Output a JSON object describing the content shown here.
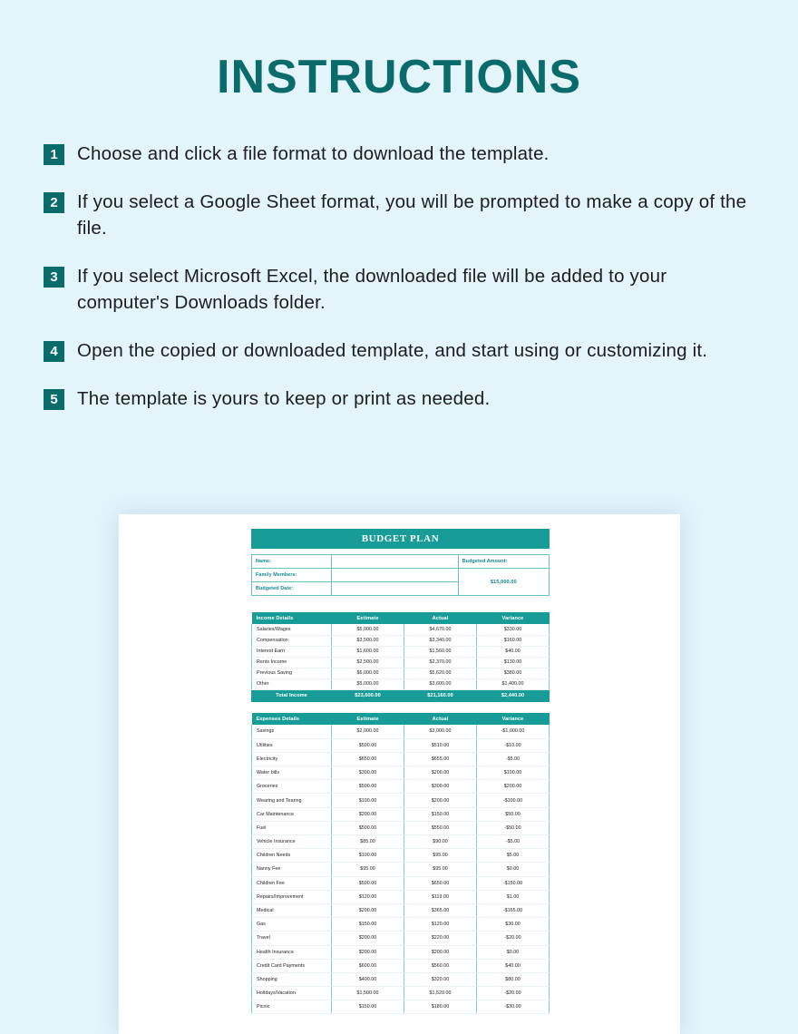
{
  "header": {
    "title": "INSTRUCTIONS"
  },
  "steps": [
    {
      "number": "1",
      "text": "Choose and click a file format to download the template."
    },
    {
      "number": "2",
      "text": "If you select a Google Sheet format, you will be prompted to make a copy of the file."
    },
    {
      "number": "3",
      "text": "If you select Microsoft Excel, the downloaded file will be added to your computer's Downloads folder."
    },
    {
      "number": "4",
      "text": "Open the copied or downloaded template, and start using or customizing it."
    },
    {
      "number": "5",
      "text": "The template is yours to keep or print as needed."
    }
  ],
  "preview": {
    "doc_title": "BUDGET PLAN",
    "info": {
      "name_label": "Name:",
      "name_value": "",
      "family_label": "Family Members:",
      "family_value": "",
      "date_label": "Budgeted Date:",
      "date_value": "",
      "budgeted_amount_label": "Budgeted Amount:",
      "budgeted_amount_value": "$15,000.00"
    },
    "income": {
      "headers": [
        "Income Details",
        "Estimate",
        "Actual",
        "Variance"
      ],
      "rows": [
        [
          "Salaries/Wages",
          "$5,000.00",
          "$4,670.00",
          "$330.00"
        ],
        [
          "Compensation",
          "$3,500.00",
          "$3,340.00",
          "$160.00"
        ],
        [
          "Interest Earn",
          "$1,600.00",
          "$1,560.00",
          "$40.00"
        ],
        [
          "Rents Income",
          "$2,500.00",
          "$2,370.00",
          "$130.00"
        ],
        [
          "Previous Saving",
          "$6,000.00",
          "$5,620.00",
          "$380.00"
        ],
        [
          "Other",
          "$5,000.00",
          "$3,600.00",
          "$1,400.00"
        ]
      ],
      "total": [
        "Total Income",
        "$23,600.00",
        "$21,160.00",
        "$2,440.00"
      ]
    },
    "expenses": {
      "headers": [
        "Expenses Details",
        "Estimate",
        "Actual",
        "Variance"
      ],
      "rows": [
        [
          "Savings",
          "$2,000.00",
          "$3,000.00",
          "-$1,000.00"
        ],
        [
          "Utilities",
          "$500.00",
          "$510.00",
          "-$10.00"
        ],
        [
          "Electricity",
          "$650.00",
          "$655.00",
          "-$5.00"
        ],
        [
          "Water bills",
          "$300.00",
          "$200.00",
          "$100.00"
        ],
        [
          "Groceries",
          "$500.00",
          "$300.00",
          "$200.00"
        ],
        [
          "Wearing and Tearing",
          "$100.00",
          "$200.00",
          "-$100.00"
        ],
        [
          "Car Maintenance",
          "$200.00",
          "$150.00",
          "$50.00"
        ],
        [
          "Fuel",
          "$500.00",
          "$550.00",
          "-$50.00"
        ],
        [
          "Vehicle Insurance",
          "$85.00",
          "$90.00",
          "-$5.00"
        ],
        [
          "Children Needs",
          "$100.00",
          "$95.00",
          "$5.00"
        ],
        [
          "Nanny Fee",
          "$95.00",
          "$95.00",
          "$0.00"
        ],
        [
          "Children Fee",
          "$500.00",
          "$650.00",
          "-$150.00"
        ],
        [
          "Repairs/Improvement",
          "$120.00",
          "$119.00",
          "$1.00"
        ],
        [
          "Medical",
          "$200.00",
          "$365.00",
          "-$165.00"
        ],
        [
          "Gas",
          "$150.00",
          "$120.00",
          "$30.00"
        ],
        [
          "Travel",
          "$200.00",
          "$220.00",
          "-$20.00"
        ],
        [
          "Health Insurance",
          "$200.00",
          "$200.00",
          "$0.00"
        ],
        [
          "Credit Card Payments",
          "$600.00",
          "$560.00",
          "$40.00"
        ],
        [
          "Shopping",
          "$400.00",
          "$320.00",
          "$80.00"
        ],
        [
          "Holidays/Vacation",
          "$1,500.00",
          "$1,520.00",
          "-$20.00"
        ],
        [
          "Picnic",
          "$150.00",
          "$180.00",
          "-$30.00"
        ]
      ]
    }
  },
  "colors": {
    "background": "#e3f4fb",
    "title_teal": "#0a6b6b",
    "table_teal": "#179c97",
    "border_teal": "#67c4c2"
  }
}
